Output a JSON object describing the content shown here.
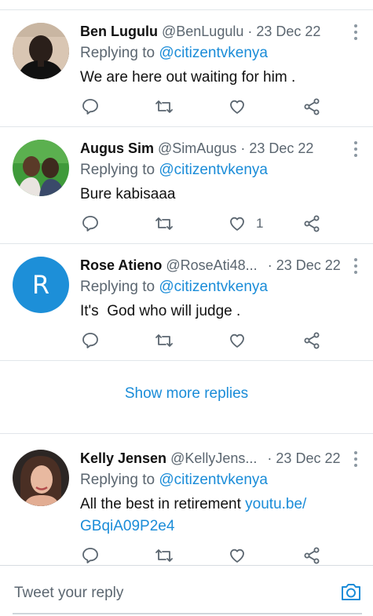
{
  "tweets": [
    {
      "name": "Ben Lugulu",
      "handle": "@BenLugulu",
      "separator": "·",
      "date": "23 Dec 22",
      "replying_prefix": "Replying to ",
      "replying_to": "@citizentvkenya",
      "text": "We are here out waiting for him .",
      "like_count": ""
    },
    {
      "name": "Augus Sim",
      "handle": "@SimAugus",
      "separator": "·",
      "date": "23 Dec 22",
      "replying_prefix": "Replying to ",
      "replying_to": "@citizentvkenya",
      "text": "Bure kabisaaa",
      "like_count": "1"
    },
    {
      "name": "Rose Atieno",
      "handle": "@RoseAti48...",
      "separator": "·",
      "date": "23 Dec 22",
      "avatar_letter": "R",
      "replying_prefix": "Replying to ",
      "replying_to": "@citizentvkenya",
      "text": "It's  God who will judge .",
      "like_count": ""
    },
    {
      "name": "Kelly Jensen",
      "handle": "@KellyJens...",
      "separator": "·",
      "date": "23 Dec 22",
      "replying_prefix": "Replying to ",
      "replying_to": "@citizentvkenya",
      "text": "All the best in retirement ",
      "link_line1": "youtu.be/",
      "link_line2": "GBqiA09P2e4",
      "like_count": ""
    }
  ],
  "show_more_label": "Show more replies",
  "reply_bar": {
    "placeholder": "Tweet your reply",
    "camera_icon": "camera-icon"
  },
  "colors": {
    "accent": "#1a8cd8",
    "muted": "#5b6670",
    "rose_avatar": "#1d8fd8"
  }
}
